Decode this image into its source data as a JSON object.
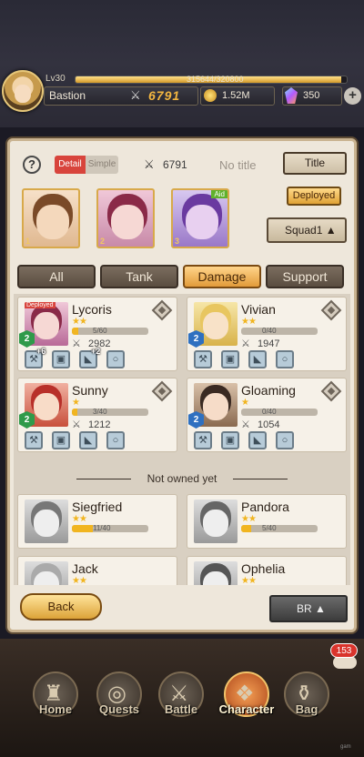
{
  "player": {
    "level": "Lv30",
    "xp": "315644/320800",
    "xp_fraction": 0.98,
    "name": "Bastion",
    "power": "6791",
    "gold": "1.52M",
    "gems": "350",
    "add_label": "+"
  },
  "panel": {
    "help_label": "?",
    "toggle": {
      "detail": "Detail",
      "simple": "Simple"
    },
    "team_power": "6791",
    "title_text": "No title",
    "title_button": "Title",
    "deployed_button": "Deployed",
    "squad_button": "Squad1 ▲",
    "slots": [
      {
        "num": "1",
        "aid": ""
      },
      {
        "num": "2",
        "aid": ""
      },
      {
        "num": "3",
        "aid": "Aid"
      }
    ],
    "tabs": [
      "All",
      "Tank",
      "Damage",
      "Support"
    ],
    "active_tab": "Damage"
  },
  "characters": [
    {
      "name": "Lycoris",
      "stars": "★★",
      "progress": "5/60",
      "progress_fraction": 0.08,
      "power": "2982",
      "level": "2",
      "deployed": "Deployed",
      "plus": [
        "+6",
        "+2"
      ]
    },
    {
      "name": "Vivian",
      "stars": "★★",
      "progress": "0/40",
      "progress_fraction": 0,
      "power": "1947",
      "level": "2"
    },
    {
      "name": "Sunny",
      "stars": "★",
      "progress": "3/40",
      "progress_fraction": 0.075,
      "power": "1212",
      "level": "2"
    },
    {
      "name": "Gloaming",
      "stars": "★",
      "progress": "0/40",
      "progress_fraction": 0,
      "power": "1054",
      "level": "2"
    }
  ],
  "not_owned_label": "Not owned yet",
  "not_owned": [
    {
      "name": "Siegfried",
      "stars": "★★",
      "progress": "11/40",
      "progress_fraction": 0.275
    },
    {
      "name": "Pandora",
      "stars": "★★",
      "progress": "5/40",
      "progress_fraction": 0.125
    },
    {
      "name": "Jack",
      "stars": "★★"
    },
    {
      "name": "Ophelia",
      "stars": "★★"
    }
  ],
  "buttons": {
    "back": "Back",
    "br": "BR ▲"
  },
  "nav": [
    "Home",
    "Quests",
    "Battle",
    "Character",
    "Bag"
  ],
  "active_nav": "Character",
  "chat_count": "153",
  "watermark": "gam"
}
